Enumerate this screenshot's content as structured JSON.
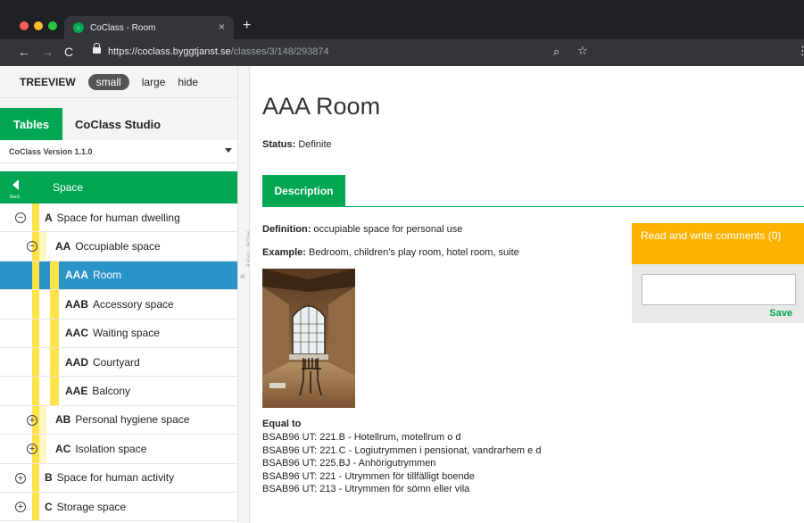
{
  "browser": {
    "tab_title": "CoClass - Room",
    "tab_favicon": "coclass-favicon",
    "tab_close": "×",
    "new_tab": "+",
    "url_host": "https://coclass.byggtjanst.se",
    "url_path": "/classes/3/148/293874"
  },
  "sidebar": {
    "treeview_title": "TREEVIEW",
    "size_options": [
      {
        "label": "small",
        "active": true
      },
      {
        "label": "large",
        "active": false
      },
      {
        "label": "hide",
        "active": false
      }
    ],
    "tabs": [
      {
        "label": "Tables",
        "active": true
      },
      {
        "label": "CoClass Studio",
        "active": false
      }
    ],
    "version": "CoClass Version 1.1.0",
    "back_label": "Back",
    "header": "Space",
    "nodes": [
      {
        "level": 1,
        "toggle": "⊖",
        "code": "A",
        "label": "Space for human dwelling"
      },
      {
        "level": 2,
        "toggle": "⊖",
        "code": "AA",
        "label": "Occupiable space"
      },
      {
        "level": 3,
        "code": "AAA",
        "label": "Room",
        "selected": true
      },
      {
        "level": 3,
        "code": "AAB",
        "label": "Accessory space"
      },
      {
        "level": 3,
        "code": "AAC",
        "label": "Waiting space"
      },
      {
        "level": 3,
        "code": "AAD",
        "label": "Courtyard"
      },
      {
        "level": 3,
        "code": "AAE",
        "label": "Balcony"
      },
      {
        "level": 2,
        "toggle": "⊕",
        "code": "AB",
        "label": "Personal hygiene space"
      },
      {
        "level": 2,
        "toggle": "⊕",
        "code": "AC",
        "label": "Isolation space"
      },
      {
        "level": 1,
        "toggle": "⊕",
        "code": "B",
        "label": "Space for human activity"
      },
      {
        "level": 1,
        "toggle": "⊕",
        "code": "C",
        "label": "Storage space"
      }
    ],
    "hide_tree_label": "HIDE TREE",
    "hide_tree_arrow": "«"
  },
  "main": {
    "title": "AAA Room",
    "status_label": "Status:",
    "status_value": "Definite",
    "description_tab": "Description",
    "definition_label": "Definition:",
    "definition_value": "occupiable space for personal use",
    "example_label": "Example:",
    "example_value": "Bedroom, children’s play room, hotel room, suite",
    "equal_title": "Equal to",
    "equal_items": [
      "BSAB96 UT: 221.B - Hotellrum, motellrum o d",
      "BSAB96 UT: 221.C - Logiutrymmen i pensionat, vandrarhem e d",
      "BSAB96 UT: 225.BJ - Anhörigutrymmen",
      "BSAB96 UT: 221 - Utrymmen för tillfälligt boende",
      "BSAB96 UT: 213 - Utrymmen för sömn eller vila"
    ],
    "comments_header": "Read and write comments (0)",
    "save_label": "Save"
  },
  "colors": {
    "brand_green": "#00a651",
    "selected_blue": "#2a93c8",
    "tree_yellow": "#fde24a",
    "comments_orange": "#ffb300"
  }
}
